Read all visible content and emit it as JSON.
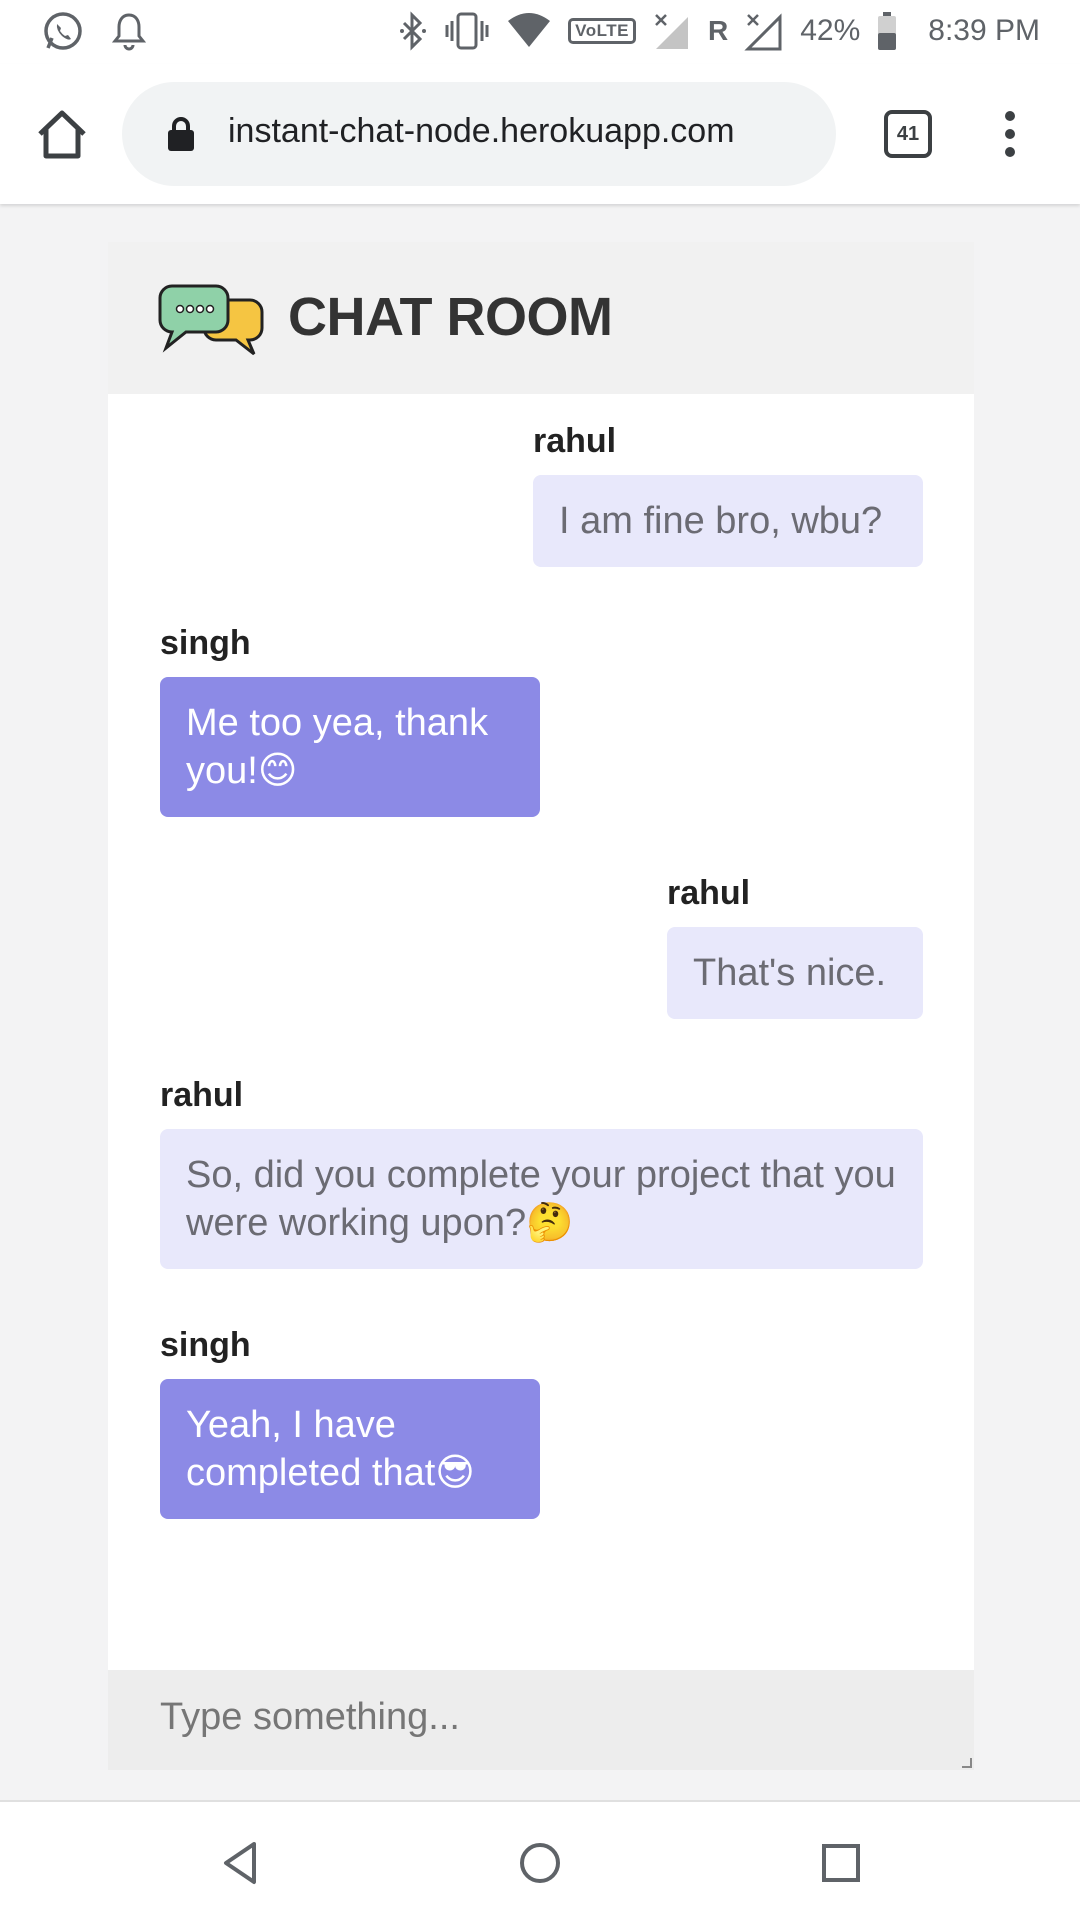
{
  "status_bar": {
    "left_icons": [
      "whatsapp-icon",
      "bell-icon"
    ],
    "right_icons": [
      "bluetooth-icon",
      "vibrate-icon",
      "wifi-icon",
      "volte-badge",
      "signal-icon",
      "roaming-icon",
      "signal-icon",
      "battery-icon"
    ],
    "volte": "VoLTE",
    "roaming": "R",
    "battery": "42%",
    "time": "8:39 PM"
  },
  "browser": {
    "url": "instant-chat-node.herokuapp.com",
    "tab_count": "41"
  },
  "chat": {
    "title": "CHAT ROOM",
    "messages": [
      {
        "sender": "rahul",
        "text": "I am fine bro, wbu?",
        "align": "right",
        "style": "light"
      },
      {
        "sender": "singh",
        "text": "Me too yea, thank you!😊",
        "align": "left",
        "style": "dark"
      },
      {
        "sender": "rahul",
        "text": "That's nice.",
        "align": "right",
        "style": "light"
      },
      {
        "sender": "rahul",
        "text": "So, did you complete your project that you were working upon?🤔",
        "align": "left",
        "style": "light"
      },
      {
        "sender": "singh",
        "text": "Yeah, I have completed that😎",
        "align": "left",
        "style": "dark"
      }
    ],
    "input_placeholder": "Type something..."
  },
  "nav": {
    "buttons": [
      "back-icon",
      "home-circle-icon",
      "recents-icon"
    ]
  },
  "colors": {
    "bubble_light": "#e8e8fb",
    "bubble_dark": "#8c8ae6",
    "header_bg": "#f1f1f1",
    "page_bg": "#f3f3f4"
  }
}
